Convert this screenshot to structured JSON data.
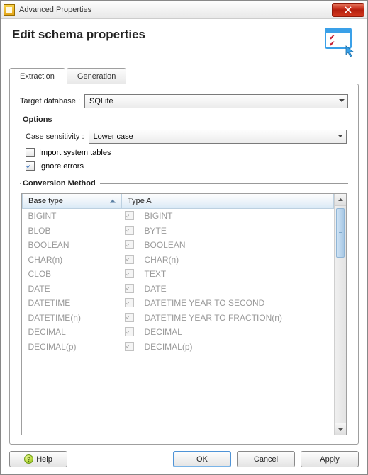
{
  "window_title": "Advanced Properties",
  "page_title": "Edit schema properties",
  "tabs": {
    "extraction": "Extraction",
    "generation": "Generation"
  },
  "target_db_label": "Target database :",
  "target_db_value": "SQLite",
  "options_legend": "Options",
  "case_label": "Case sensitivity :",
  "case_value": "Lower case",
  "import_tables_label": "Import system tables",
  "ignore_errors_label": "Ignore errors",
  "conversion_legend": "Conversion Method",
  "col_base": "Base type",
  "col_a": "Type A",
  "rows": [
    {
      "base": "BIGINT",
      "a": "BIGINT"
    },
    {
      "base": "BLOB",
      "a": "BYTE"
    },
    {
      "base": "BOOLEAN",
      "a": "BOOLEAN"
    },
    {
      "base": "CHAR(n)",
      "a": "CHAR(n)"
    },
    {
      "base": "CLOB",
      "a": "TEXT"
    },
    {
      "base": "DATE",
      "a": "DATE"
    },
    {
      "base": "DATETIME",
      "a": "DATETIME YEAR TO SECOND"
    },
    {
      "base": "DATETIME(n)",
      "a": "DATETIME YEAR TO FRACTION(n)"
    },
    {
      "base": "DECIMAL",
      "a": "DECIMAL"
    },
    {
      "base": "DECIMAL(p)",
      "a": "DECIMAL(p)"
    }
  ],
  "buttons": {
    "help": "Help",
    "ok": "OK",
    "cancel": "Cancel",
    "apply": "Apply"
  }
}
